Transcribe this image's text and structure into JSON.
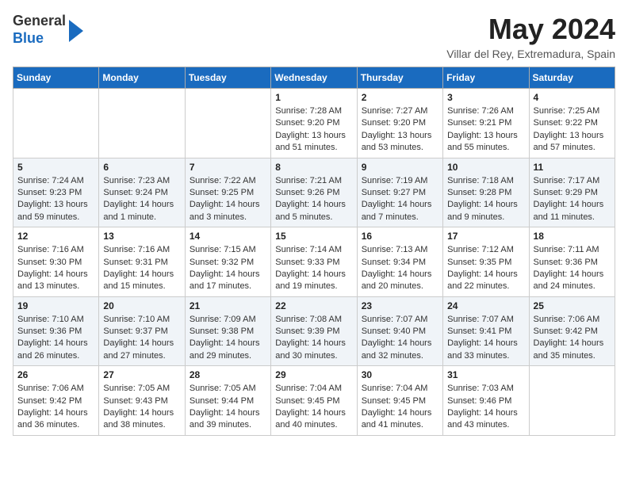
{
  "header": {
    "logo_line1": "General",
    "logo_line2": "Blue",
    "month_title": "May 2024",
    "location": "Villar del Rey, Extremadura, Spain"
  },
  "weekdays": [
    "Sunday",
    "Monday",
    "Tuesday",
    "Wednesday",
    "Thursday",
    "Friday",
    "Saturday"
  ],
  "weeks": [
    [
      {
        "day": "",
        "info": ""
      },
      {
        "day": "",
        "info": ""
      },
      {
        "day": "",
        "info": ""
      },
      {
        "day": "1",
        "info": "Sunrise: 7:28 AM\nSunset: 9:20 PM\nDaylight: 13 hours\nand 51 minutes."
      },
      {
        "day": "2",
        "info": "Sunrise: 7:27 AM\nSunset: 9:20 PM\nDaylight: 13 hours\nand 53 minutes."
      },
      {
        "day": "3",
        "info": "Sunrise: 7:26 AM\nSunset: 9:21 PM\nDaylight: 13 hours\nand 55 minutes."
      },
      {
        "day": "4",
        "info": "Sunrise: 7:25 AM\nSunset: 9:22 PM\nDaylight: 13 hours\nand 57 minutes."
      }
    ],
    [
      {
        "day": "5",
        "info": "Sunrise: 7:24 AM\nSunset: 9:23 PM\nDaylight: 13 hours\nand 59 minutes."
      },
      {
        "day": "6",
        "info": "Sunrise: 7:23 AM\nSunset: 9:24 PM\nDaylight: 14 hours\nand 1 minute."
      },
      {
        "day": "7",
        "info": "Sunrise: 7:22 AM\nSunset: 9:25 PM\nDaylight: 14 hours\nand 3 minutes."
      },
      {
        "day": "8",
        "info": "Sunrise: 7:21 AM\nSunset: 9:26 PM\nDaylight: 14 hours\nand 5 minutes."
      },
      {
        "day": "9",
        "info": "Sunrise: 7:19 AM\nSunset: 9:27 PM\nDaylight: 14 hours\nand 7 minutes."
      },
      {
        "day": "10",
        "info": "Sunrise: 7:18 AM\nSunset: 9:28 PM\nDaylight: 14 hours\nand 9 minutes."
      },
      {
        "day": "11",
        "info": "Sunrise: 7:17 AM\nSunset: 9:29 PM\nDaylight: 14 hours\nand 11 minutes."
      }
    ],
    [
      {
        "day": "12",
        "info": "Sunrise: 7:16 AM\nSunset: 9:30 PM\nDaylight: 14 hours\nand 13 minutes."
      },
      {
        "day": "13",
        "info": "Sunrise: 7:16 AM\nSunset: 9:31 PM\nDaylight: 14 hours\nand 15 minutes."
      },
      {
        "day": "14",
        "info": "Sunrise: 7:15 AM\nSunset: 9:32 PM\nDaylight: 14 hours\nand 17 minutes."
      },
      {
        "day": "15",
        "info": "Sunrise: 7:14 AM\nSunset: 9:33 PM\nDaylight: 14 hours\nand 19 minutes."
      },
      {
        "day": "16",
        "info": "Sunrise: 7:13 AM\nSunset: 9:34 PM\nDaylight: 14 hours\nand 20 minutes."
      },
      {
        "day": "17",
        "info": "Sunrise: 7:12 AM\nSunset: 9:35 PM\nDaylight: 14 hours\nand 22 minutes."
      },
      {
        "day": "18",
        "info": "Sunrise: 7:11 AM\nSunset: 9:36 PM\nDaylight: 14 hours\nand 24 minutes."
      }
    ],
    [
      {
        "day": "19",
        "info": "Sunrise: 7:10 AM\nSunset: 9:36 PM\nDaylight: 14 hours\nand 26 minutes."
      },
      {
        "day": "20",
        "info": "Sunrise: 7:10 AM\nSunset: 9:37 PM\nDaylight: 14 hours\nand 27 minutes."
      },
      {
        "day": "21",
        "info": "Sunrise: 7:09 AM\nSunset: 9:38 PM\nDaylight: 14 hours\nand 29 minutes."
      },
      {
        "day": "22",
        "info": "Sunrise: 7:08 AM\nSunset: 9:39 PM\nDaylight: 14 hours\nand 30 minutes."
      },
      {
        "day": "23",
        "info": "Sunrise: 7:07 AM\nSunset: 9:40 PM\nDaylight: 14 hours\nand 32 minutes."
      },
      {
        "day": "24",
        "info": "Sunrise: 7:07 AM\nSunset: 9:41 PM\nDaylight: 14 hours\nand 33 minutes."
      },
      {
        "day": "25",
        "info": "Sunrise: 7:06 AM\nSunset: 9:42 PM\nDaylight: 14 hours\nand 35 minutes."
      }
    ],
    [
      {
        "day": "26",
        "info": "Sunrise: 7:06 AM\nSunset: 9:42 PM\nDaylight: 14 hours\nand 36 minutes."
      },
      {
        "day": "27",
        "info": "Sunrise: 7:05 AM\nSunset: 9:43 PM\nDaylight: 14 hours\nand 38 minutes."
      },
      {
        "day": "28",
        "info": "Sunrise: 7:05 AM\nSunset: 9:44 PM\nDaylight: 14 hours\nand 39 minutes."
      },
      {
        "day": "29",
        "info": "Sunrise: 7:04 AM\nSunset: 9:45 PM\nDaylight: 14 hours\nand 40 minutes."
      },
      {
        "day": "30",
        "info": "Sunrise: 7:04 AM\nSunset: 9:45 PM\nDaylight: 14 hours\nand 41 minutes."
      },
      {
        "day": "31",
        "info": "Sunrise: 7:03 AM\nSunset: 9:46 PM\nDaylight: 14 hours\nand 43 minutes."
      },
      {
        "day": "",
        "info": ""
      }
    ]
  ]
}
